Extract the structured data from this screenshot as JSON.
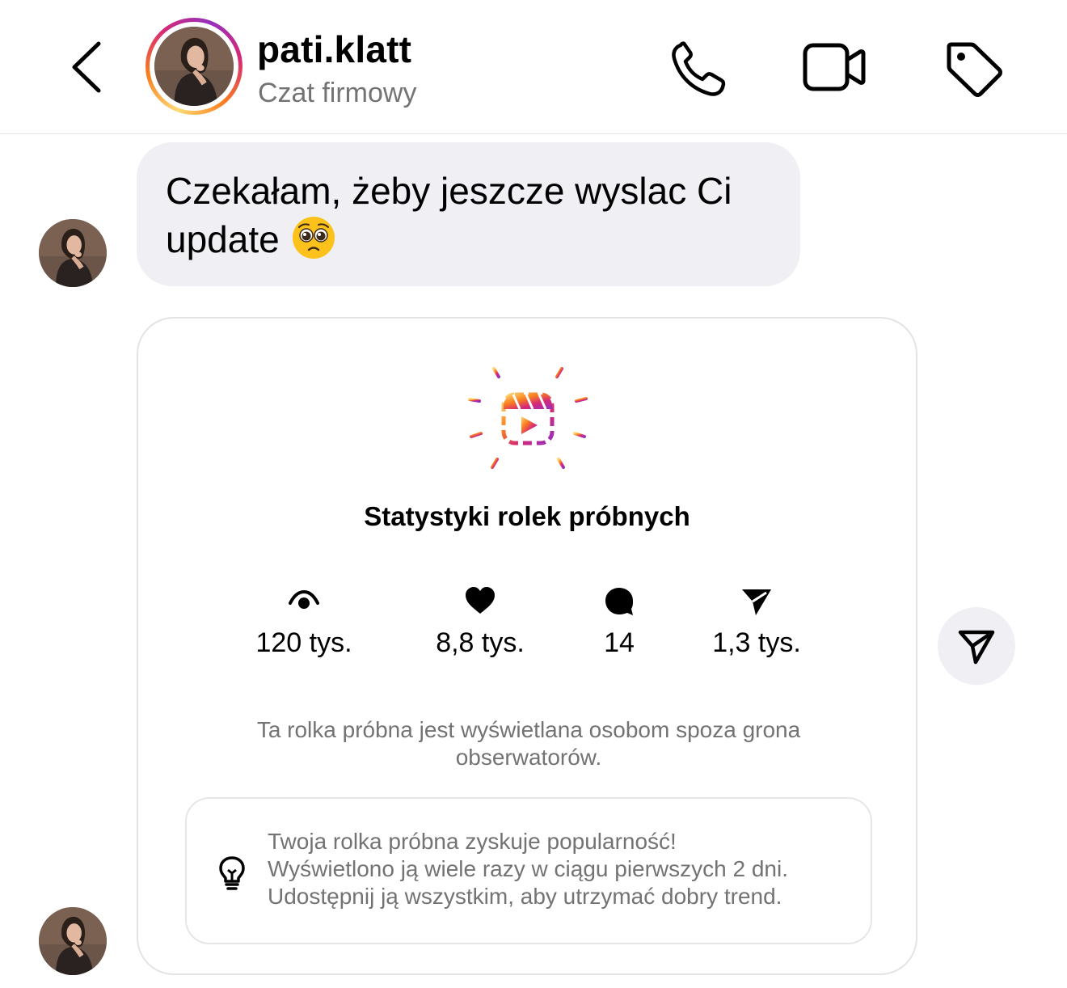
{
  "header": {
    "username": "pati.klatt",
    "subtitle": "Czat firmowy",
    "icons": [
      "back-icon",
      "phone-icon",
      "video-camera-icon",
      "tag-icon"
    ]
  },
  "messages": {
    "text_message": "Czekałam, żeby jeszcze wyslac Ci update",
    "emoji": "pleading-face"
  },
  "insights_card": {
    "title": "Statystyki rolek próbnych",
    "stats": [
      {
        "icon": "eye-icon",
        "value": "120 tys."
      },
      {
        "icon": "heart-icon",
        "value": "8,8 tys."
      },
      {
        "icon": "comment-icon",
        "value": "14"
      },
      {
        "icon": "send-icon",
        "value": "1,3 tys."
      }
    ],
    "description": "Ta rolka próbna jest wyświetlana osobom spoza grona obserwatorów.",
    "tip": {
      "line1": "Twoja rolka próbna zyskuje popularność!",
      "line2": "Wyświetlono ją wiele razy w ciągu pierwszych 2 dni.",
      "line3": "Udostępnij ją wszystkim, aby utrzymać dobry trend."
    }
  },
  "colors": {
    "bubble_bg": "#efeff4",
    "secondary_text": "#737373",
    "gradient": [
      "#feda75",
      "#fa7e1e",
      "#d62976",
      "#962fbf"
    ]
  }
}
